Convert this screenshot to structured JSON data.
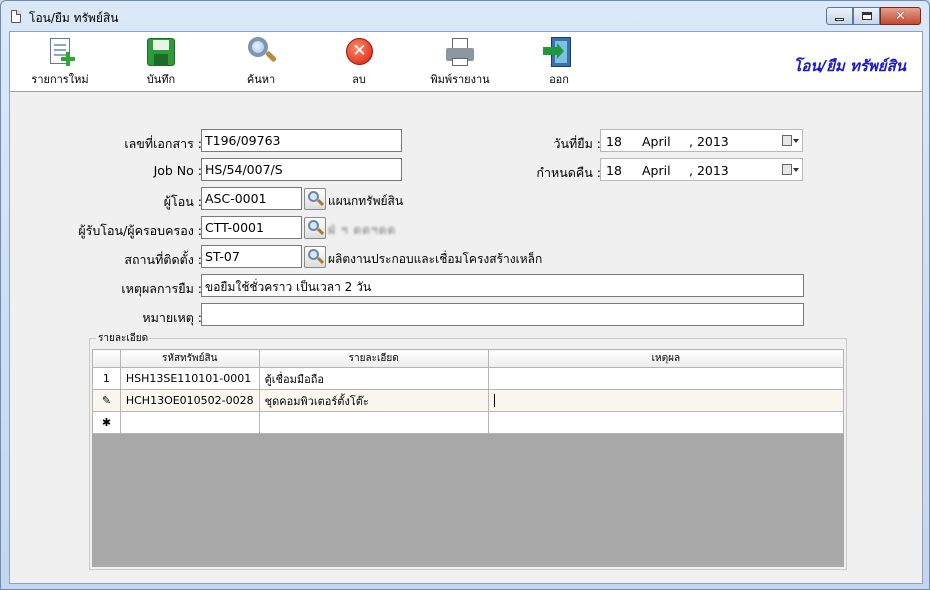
{
  "window": {
    "title": "โอน/ยืม ทรัพย์สิน"
  },
  "toolbar": {
    "buttons": [
      {
        "label": "รายการใหม่",
        "icon": "new-document-icon"
      },
      {
        "label": "บันทึก",
        "icon": "save-icon"
      },
      {
        "label": "ค้นหา",
        "icon": "search-icon"
      },
      {
        "label": "ลบ",
        "icon": "delete-icon"
      },
      {
        "label": "พิมพ์รายงาน",
        "icon": "print-icon"
      },
      {
        "label": "ออก",
        "icon": "exit-door-icon"
      }
    ],
    "header_title": "โอน/ยืม ทรัพย์สิน"
  },
  "form": {
    "doc_no_label": "เลขที่เอกสาร :",
    "doc_no": "T196/09763",
    "job_no_label": "Job No :",
    "job_no": "HS/54/007/S",
    "transferor_label": "ผู้โอน :",
    "transferor_code": "ASC-0001",
    "transferor_name": "แผนกทรัพย์สิน",
    "receiver_label": "ผู้รับโอน/ผู้ครอบครอง :",
    "receiver_code": "CTT-0001",
    "receiver_name": "ฝ่ ฯ ดดฯดด",
    "location_label": "สถานที่ติดตั้ง :",
    "location_code": "ST-07",
    "location_name": "ผลิตงานประกอบและเชื่อมโครงสร้างเหล็ก",
    "reason_label": "เหตุผลการยืม :",
    "reason": "ขอยืมใช้ชั่วคราว เป็นเวลา 2 วัน",
    "note_label": "หมายเหตุ :",
    "note": "",
    "borrow_date_label": "วันที่ยืม :",
    "borrow_date": {
      "day": "18",
      "month": "April",
      "year": ", 2013"
    },
    "return_date_label": "กำหนดคืน :",
    "return_date": {
      "day": "18",
      "month": "April",
      "year": ", 2013"
    }
  },
  "details": {
    "group_title": "รายละเอียด",
    "columns": [
      "รหัสทรัพย์สิน",
      "รายละเอียด",
      "เหตุผล"
    ],
    "rows": [
      {
        "marker": "1",
        "code": "HSH13SE110101-0001",
        "desc": "ตู้เชื่อมมือถือ",
        "reason": ""
      },
      {
        "marker": "✎",
        "code": "HCH13OE010502-0028",
        "desc": "ชุดคอมพิวเตอร์ตั้งโต๊ะ",
        "reason": ""
      },
      {
        "marker": "✱",
        "code": "",
        "desc": "",
        "reason": ""
      }
    ]
  }
}
